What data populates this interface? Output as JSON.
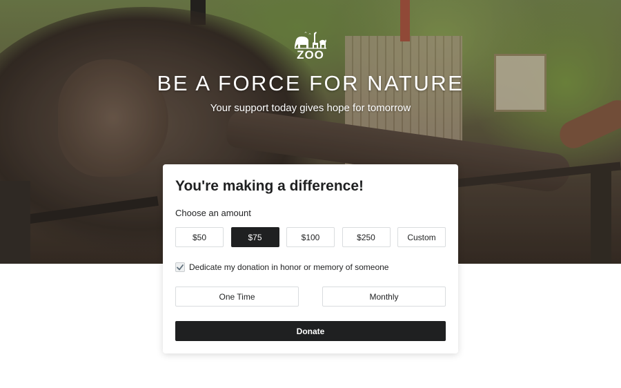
{
  "hero": {
    "logo_text": "ZOO",
    "headline": "BE A FORCE FOR NATURE",
    "subheadline": "Your support today gives hope for tomorrow"
  },
  "form": {
    "title": "You're making a difference!",
    "amount_label": "Choose an amount",
    "amounts": [
      {
        "label": "$50",
        "selected": false
      },
      {
        "label": "$75",
        "selected": true
      },
      {
        "label": "$100",
        "selected": false
      },
      {
        "label": "$250",
        "selected": false
      },
      {
        "label": "Custom",
        "selected": false
      }
    ],
    "dedicate": {
      "label": "Dedicate my donation in honor or memory of someone",
      "checked": true
    },
    "frequency": [
      {
        "label": "One Time"
      },
      {
        "label": "Monthly"
      }
    ],
    "donate_label": "Donate"
  },
  "colors": {
    "primary": "#1f2021",
    "border": "#d9dcde",
    "card_bg": "#ffffff",
    "check_color": "#5f6f7b"
  },
  "icons": {
    "logo": "zoo-animals-silhouette-icon",
    "checkbox": "checkmark-icon"
  }
}
